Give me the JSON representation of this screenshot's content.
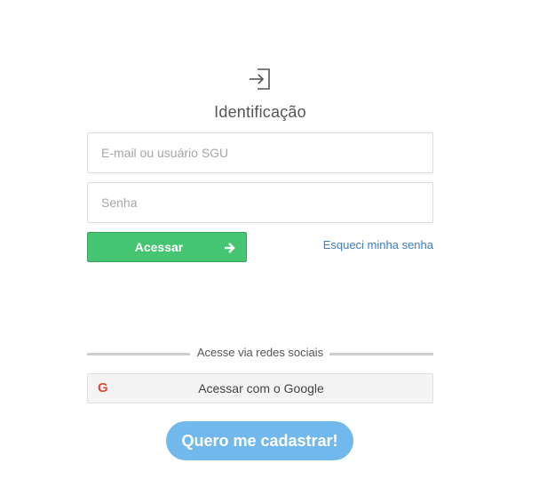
{
  "header": {
    "icon": "sign-in-icon",
    "title": "Identificação"
  },
  "form": {
    "email_placeholder": "E-mail ou usuário SGU",
    "email_value": "",
    "password_placeholder": "Senha",
    "password_value": "",
    "submit_label": "Acessar",
    "submit_icon": "arrow-right-icon",
    "forgot_label": "Esqueci minha senha"
  },
  "social": {
    "divider_text": "Acesse via redes sociais",
    "google_icon": "google-g-icon",
    "google_icon_glyph": "G",
    "google_label": "Acessar com o Google"
  },
  "signup": {
    "label": "Quero me cadastrar!"
  },
  "colors": {
    "primary_green": "#45c472",
    "link_blue": "#3d7ebf",
    "signup_blue": "#71b9ec",
    "google_red": "#dd4b39"
  }
}
